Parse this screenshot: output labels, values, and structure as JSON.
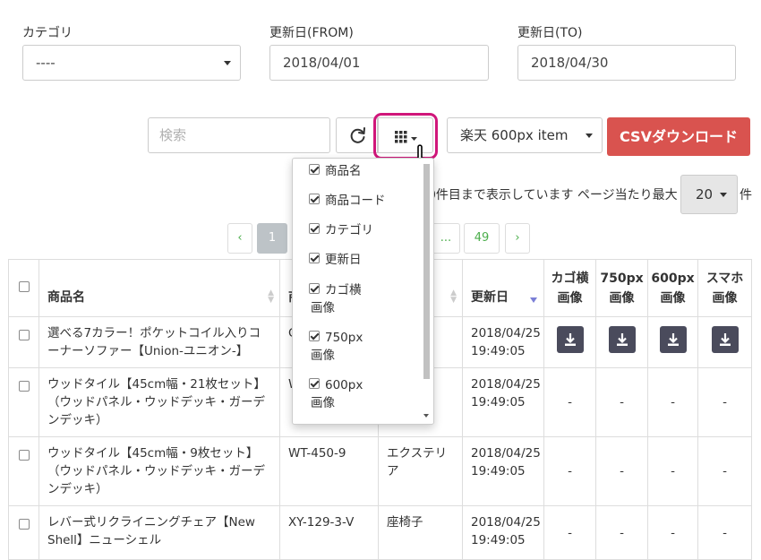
{
  "filters": {
    "category_label": "カテゴリ",
    "category_value": "----",
    "from_label": "更新日(FROM)",
    "from_value": "2018/04/01",
    "to_label": "更新日(TO)",
    "to_value": "2018/04/30"
  },
  "toolbar": {
    "search_placeholder": "検索",
    "format_value": "楽天 600px item",
    "csv_label": "CSVダウンロード"
  },
  "column_menu": {
    "items": [
      {
        "label": "商品名",
        "checked": true
      },
      {
        "label": "商品コード",
        "checked": true
      },
      {
        "label": "カテゴリ",
        "checked": true
      },
      {
        "label": "更新日",
        "checked": true
      },
      {
        "label_1": "カゴ横",
        "label_2": "画像",
        "checked": true
      },
      {
        "label_1": "750px",
        "label_2": "画像",
        "checked": true
      },
      {
        "label_1": "600px",
        "label_2": "画像",
        "checked": true
      }
    ]
  },
  "page_info": {
    "text": "0件目まで表示しています ページ当たり最大",
    "page_size": "20",
    "unit": "件"
  },
  "pagination": {
    "prev": "‹",
    "current": "1",
    "ellipsis": "...",
    "last": "49",
    "next": "›"
  },
  "table": {
    "headers": {
      "name": "商品名",
      "code": "商",
      "updated": "更新日",
      "cart_1": "カゴ横",
      "cart_2": "画像",
      "px750_1": "750px",
      "px750_2": "画像",
      "px600_1": "600px",
      "px600_2": "画像",
      "sp_1": "スマホ",
      "sp_2": "画像"
    },
    "rows": [
      {
        "name": "選べる7カラー！ポケットコイル入りコーナーソファー【Union-ユニオン-】",
        "code": "C",
        "category": "",
        "date": "2018/04/25",
        "time": "19:49:05",
        "cart": "",
        "px750": "",
        "px600": "",
        "sp": ""
      },
      {
        "name": "ウッドタイル【45cm幅・21枚セット】（ウッドパネル・ウッドデッキ・ガーデンデッキ）",
        "code": "W",
        "category": "リ",
        "date": "2018/04/25",
        "time": "19:49:05",
        "cart": "-",
        "px750": "-",
        "px600": "-",
        "sp": "-"
      },
      {
        "name": "ウッドタイル【45cm幅・9枚セット】（ウッドパネル・ウッドデッキ・ガーデンデッキ）",
        "code": "WT-450-9",
        "category": "エクステリア",
        "date": "2018/04/25",
        "time": "19:49:05",
        "cart": "-",
        "px750": "-",
        "px600": "-",
        "sp": "-"
      },
      {
        "name": "レバー式リクライニングチェア【New Shell】ニューシェル",
        "code": "XY-129-3-V",
        "category": "座椅子",
        "date": "2018/04/25",
        "time": "19:49:05",
        "cart": "-",
        "px750": "-",
        "px600": "-",
        "sp": "-"
      }
    ]
  }
}
